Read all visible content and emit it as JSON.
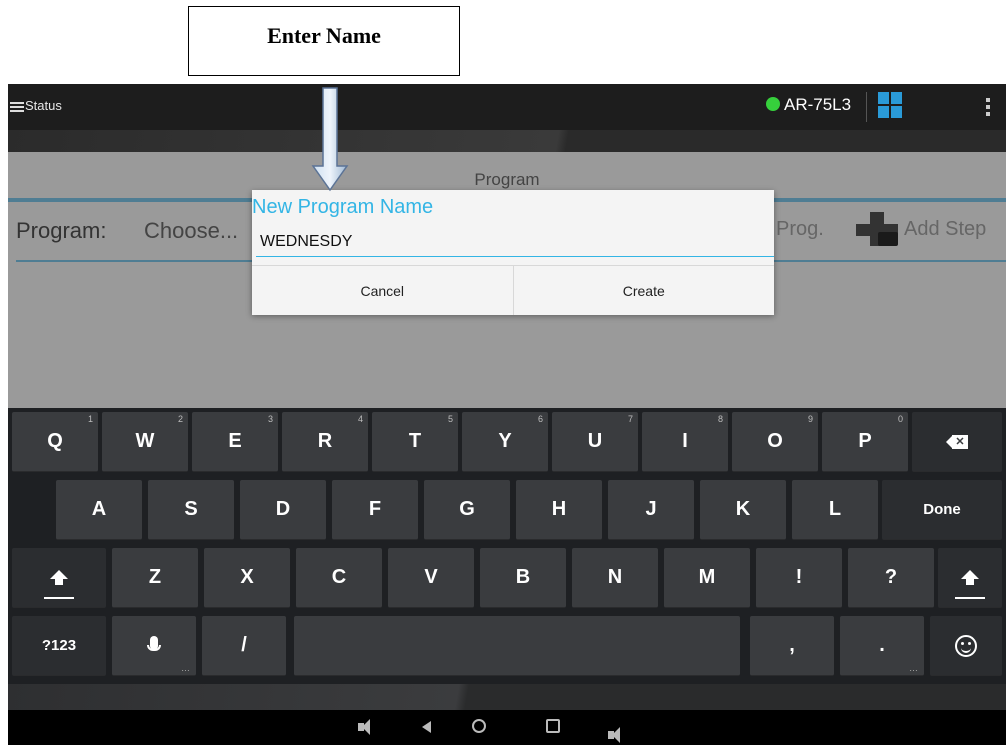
{
  "annotation": {
    "callout_text": "Enter Name"
  },
  "status_bar": {
    "menu_label": "Status",
    "device_name": "AR-75L3",
    "device_status_color": "#36d03c",
    "grid_icon_color": "#2a9bd8"
  },
  "app": {
    "screen_title": "Program",
    "program_label": "Program:",
    "program_select": "Choose...",
    "prog_button": "Prog.",
    "add_step_button": "Add Step"
  },
  "dialog": {
    "title": "New Program Name",
    "input_value": "WEDNESDY",
    "cancel": "Cancel",
    "create": "Create",
    "accent_color": "#33b5e5"
  },
  "keyboard": {
    "row1": [
      {
        "label": "Q",
        "hint": "1"
      },
      {
        "label": "W",
        "hint": "2"
      },
      {
        "label": "E",
        "hint": "3"
      },
      {
        "label": "R",
        "hint": "4"
      },
      {
        "label": "T",
        "hint": "5"
      },
      {
        "label": "Y",
        "hint": "6"
      },
      {
        "label": "U",
        "hint": "7"
      },
      {
        "label": "I",
        "hint": "8"
      },
      {
        "label": "O",
        "hint": "9"
      },
      {
        "label": "P",
        "hint": "0"
      }
    ],
    "row2": [
      "A",
      "S",
      "D",
      "F",
      "G",
      "H",
      "J",
      "K",
      "L"
    ],
    "done_label": "Done",
    "row3": [
      "Z",
      "X",
      "C",
      "V",
      "B",
      "N",
      "M",
      "!",
      "?"
    ],
    "symbols_label": "?123",
    "slash_label": "/",
    "comma_label": ",",
    "period_label": "."
  }
}
